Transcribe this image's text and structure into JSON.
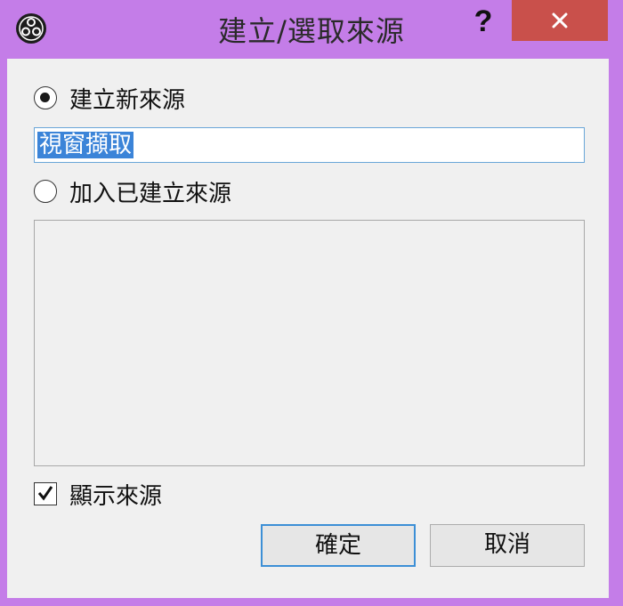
{
  "window": {
    "title": "建立/選取來源",
    "help_label": "?"
  },
  "options": {
    "create_new_label": "建立新來源",
    "create_new_selected": true,
    "add_existing_label": "加入已建立來源",
    "add_existing_selected": false
  },
  "name_input": {
    "value": "視窗擷取"
  },
  "existing_sources": [],
  "visible_checkbox": {
    "label": "顯示來源",
    "checked": true
  },
  "buttons": {
    "ok_label": "確定",
    "cancel_label": "取消"
  },
  "colors": {
    "title_bar": "#c47de8",
    "close_button": "#c9504b",
    "selection": "#3b84d8",
    "focus_border": "#3c8fd6",
    "client_bg": "#f0f0f0"
  },
  "icons": {
    "app": "obs-logo-icon",
    "close": "close-icon",
    "check": "checkmark-icon"
  }
}
